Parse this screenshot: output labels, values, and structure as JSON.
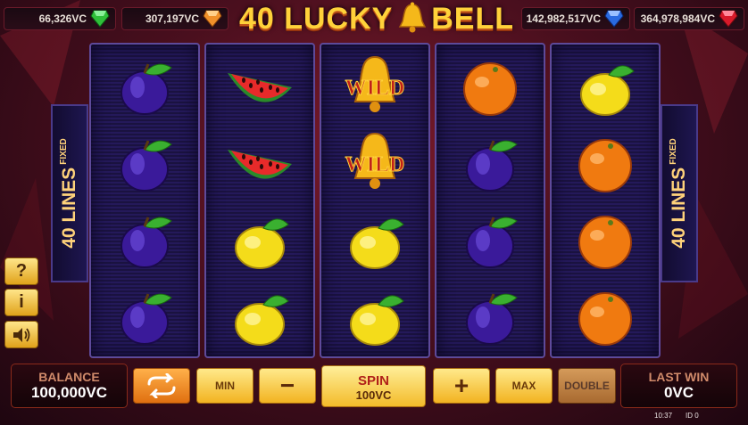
{
  "jackpots": [
    {
      "value": "66,326VC",
      "gem": "green",
      "color": "#2fbf3a"
    },
    {
      "value": "307,197VC",
      "gem": "orange",
      "color": "#f0902a"
    },
    {
      "value": "142,982,517VC",
      "gem": "blue",
      "color": "#2a6ae0"
    },
    {
      "value": "364,978,984VC",
      "gem": "red",
      "color": "#d81a2a"
    }
  ],
  "logo": {
    "text_left": "40 LUCKY",
    "text_right": "BELL"
  },
  "lines": {
    "count": "40 LINES",
    "mode": "FIXED"
  },
  "reels": [
    [
      "plum",
      "plum",
      "plum",
      "plum"
    ],
    [
      "watermelon",
      "watermelon",
      "lemon",
      "lemon"
    ],
    [
      "wild",
      "wild",
      "lemon",
      "lemon"
    ],
    [
      "orange",
      "plum",
      "plum",
      "plum"
    ],
    [
      "lemon",
      "orange",
      "orange",
      "orange"
    ]
  ],
  "wild_label": "WILD",
  "side_buttons": {
    "help": "?",
    "info": "i",
    "sound": "sound-icon"
  },
  "balance": {
    "label": "BALANCE",
    "value": "100,000VC"
  },
  "controls": {
    "min": "MIN",
    "minus": "−",
    "spin": "SPIN",
    "bet": "100VC",
    "plus": "+",
    "max": "MAX",
    "double": "DOUBLE"
  },
  "last_win": {
    "label": "LAST WIN",
    "value": "0VC"
  },
  "footer": {
    "time": "10:37",
    "id": "ID 0"
  }
}
